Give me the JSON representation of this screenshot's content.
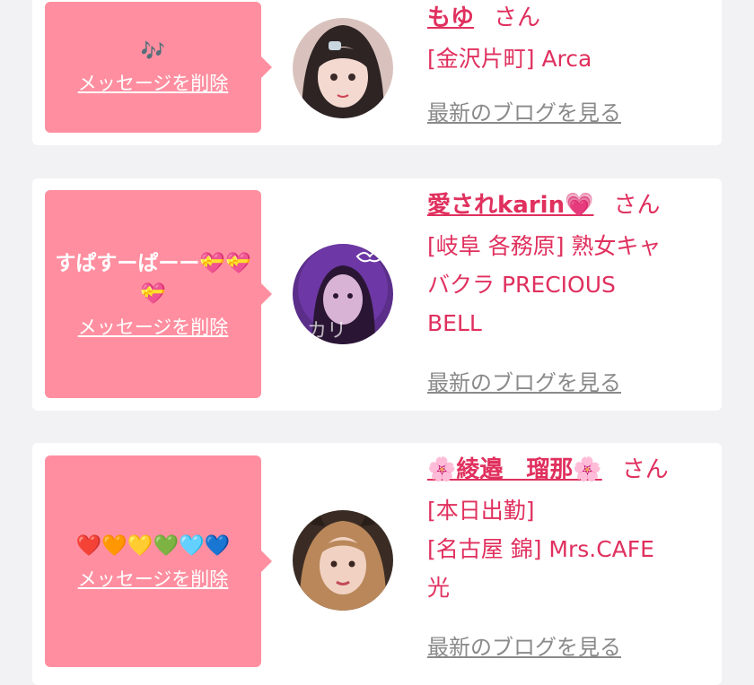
{
  "cards": [
    {
      "message": "🎶",
      "delete_label": "メッセージを削除",
      "name": "もゆ",
      "honorific": "さん",
      "lines": [
        "[金沢片町] Arca"
      ],
      "blog_link": "最新のブログを見る"
    },
    {
      "message": "すぱすーぱーー💝💝💝",
      "delete_label": "メッセージを削除",
      "name": "愛されkarin💗",
      "honorific": "さん",
      "lines": [
        "[岐阜 各務原]  熟女キャ",
        "バクラ PRECIOUS",
        "BELL"
      ],
      "blog_link": "最新のブログを見る"
    },
    {
      "message": "❤️🧡💛💚🩵💙",
      "delete_label": "メッセージを削除",
      "name": "🌸綾邉　瑠那🌸",
      "honorific": "さん",
      "lines": [
        "[本日出勤]",
        "[名古屋 錦] Mrs.CAFE",
        "光"
      ],
      "blog_link": "最新のブログを見る"
    }
  ],
  "colors": {
    "bubble": "#ff8fa0",
    "accent": "#e0305e",
    "link_gray": "#8a8a8a",
    "background": "#f2f2f4"
  }
}
